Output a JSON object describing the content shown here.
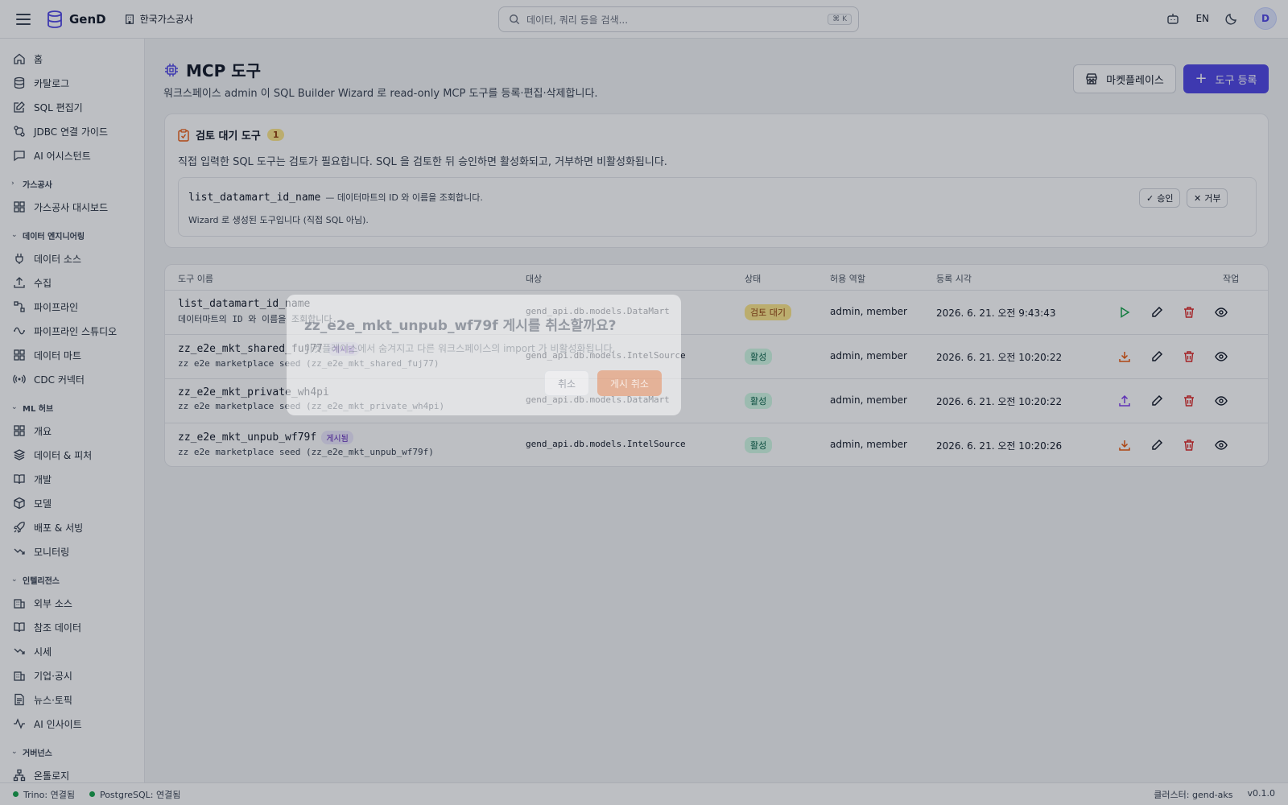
{
  "header": {
    "brand": "GenD",
    "org": "한국가스공사",
    "search_placeholder": "데이터, 쿼리 등을 검색...",
    "search_shortcut": "⌘ K",
    "lang": "EN",
    "avatar": "D"
  },
  "sidebar": {
    "top_items": [
      {
        "label": "홈",
        "icon": "home-icon"
      },
      {
        "label": "카탈로그",
        "icon": "database-icon"
      },
      {
        "label": "SQL 편집기",
        "icon": "edit-icon"
      },
      {
        "label": "JDBC 연결 가이드",
        "icon": "connection-icon"
      },
      {
        "label": "AI 어시스턴트",
        "icon": "chat-icon"
      }
    ],
    "sections": [
      {
        "title": "가스공사",
        "expanded": false,
        "items": [
          {
            "label": "가스공사 대시보드",
            "icon": "grid-icon"
          }
        ]
      },
      {
        "title": "데이터 엔지니어링",
        "expanded": true,
        "items": [
          {
            "label": "데이터 소스",
            "icon": "plug-icon"
          },
          {
            "label": "수집",
            "icon": "upload-icon"
          },
          {
            "label": "파이프라인",
            "icon": "pipeline-icon"
          },
          {
            "label": "파이프라인 스튜디오",
            "icon": "workflow-icon"
          },
          {
            "label": "데이터 마트",
            "icon": "grid-icon"
          },
          {
            "label": "CDC 커넥터",
            "icon": "broadcast-icon"
          }
        ]
      },
      {
        "title": "ML 허브",
        "expanded": true,
        "items": [
          {
            "label": "개요",
            "icon": "grid-icon"
          },
          {
            "label": "데이터 & 피처",
            "icon": "layers-icon"
          },
          {
            "label": "개발",
            "icon": "book-icon"
          },
          {
            "label": "모델",
            "icon": "box-icon"
          },
          {
            "label": "배포 & 서빙",
            "icon": "rocket-icon"
          },
          {
            "label": "모니터링",
            "icon": "trend-icon"
          }
        ]
      },
      {
        "title": "인텔리전스",
        "expanded": true,
        "items": [
          {
            "label": "외부 소스",
            "icon": "building-icon"
          },
          {
            "label": "참조 데이터",
            "icon": "book-icon"
          },
          {
            "label": "시세",
            "icon": "trend-icon"
          },
          {
            "label": "기업·공시",
            "icon": "building-icon"
          },
          {
            "label": "뉴스·토픽",
            "icon": "document-icon"
          },
          {
            "label": "AI 인사이트",
            "icon": "activity-icon"
          }
        ]
      },
      {
        "title": "거버넌스",
        "expanded": true,
        "items": [
          {
            "label": "온톨로지",
            "icon": "network-icon"
          }
        ]
      }
    ]
  },
  "page": {
    "title": "MCP 도구",
    "description": "워크스페이스 admin 이 SQL Builder Wizard 로 read-only MCP 도구를 등록·편집·삭제합니다.",
    "marketplace_button": "마켓플레이스",
    "register_button": "도구 등록"
  },
  "review": {
    "title": "검토 대기 도구",
    "count": "1",
    "description": "직접 입력한 SQL 도구는 검토가 필요합니다. SQL 을 검토한 뒤 승인하면 활성화되고, 거부하면 비활성화됩니다.",
    "item": {
      "name": "list_datamart_id_name",
      "desc": "— 데이터마트의 ID 와 이름을 조회합니다.",
      "note": "Wizard 로 생성된 도구입니다 (직접 SQL 아님).",
      "approve": "승인",
      "reject": "거부"
    }
  },
  "table": {
    "headers": {
      "name": "도구 이름",
      "target": "대상",
      "status": "상태",
      "roles": "허용 역할",
      "time": "등록 시각",
      "actions": "작업"
    },
    "rows": [
      {
        "name": "list_datamart_id_name",
        "badge": "",
        "sub": "데이터마트의 ID 와 이름을 조회합니다.",
        "target": "gend_api.db.models.DataMart",
        "status": "검토 대기",
        "status_kind": "pending",
        "roles": "admin, member",
        "time": "2026. 6. 21. 오전 9:43:43",
        "first_action": "play-icon"
      },
      {
        "name": "zz_e2e_mkt_shared_fuj77",
        "badge": "게시됨",
        "sub": "zz e2e marketplace seed (zz_e2e_mkt_shared_fuj77)",
        "target": "gend_api.db.models.IntelSource",
        "status": "활성",
        "status_kind": "active",
        "roles": "admin, member",
        "time": "2026. 6. 21. 오전 10:20:22",
        "first_action": "download-icon"
      },
      {
        "name": "zz_e2e_mkt_private_wh4pi",
        "badge": "",
        "sub": "zz e2e marketplace seed (zz_e2e_mkt_private_wh4pi)",
        "target": "gend_api.db.models.DataMart",
        "status": "활성",
        "status_kind": "active",
        "roles": "admin, member",
        "time": "2026. 6. 21. 오전 10:20:22",
        "first_action": "upload-icon"
      },
      {
        "name": "zz_e2e_mkt_unpub_wf79f",
        "badge": "게시됨",
        "sub": "zz e2e marketplace seed (zz_e2e_mkt_unpub_wf79f)",
        "target": "gend_api.db.models.IntelSource",
        "status": "활성",
        "status_kind": "active",
        "roles": "admin, member",
        "time": "2026. 6. 21. 오전 10:20:26",
        "first_action": "download-icon"
      }
    ]
  },
  "dialog": {
    "title": "zz_e2e_mkt_unpub_wf79f 게시를 취소할까요?",
    "description": "마켓플레이스에서 숨겨지고 다른 워크스페이스의 import 가 비활성화됩니다.",
    "cancel": "취소",
    "confirm": "게시 취소"
  },
  "footer": {
    "trino": "Trino: 연결됨",
    "postgres": "PostgreSQL: 연결됨",
    "cluster": "클러스터: gend-aks",
    "version": "v0.1.0"
  },
  "colors": {
    "accent": "#4f46e5",
    "danger": "#dc2626",
    "warning": "#ea580c",
    "success": "#16a34a"
  }
}
